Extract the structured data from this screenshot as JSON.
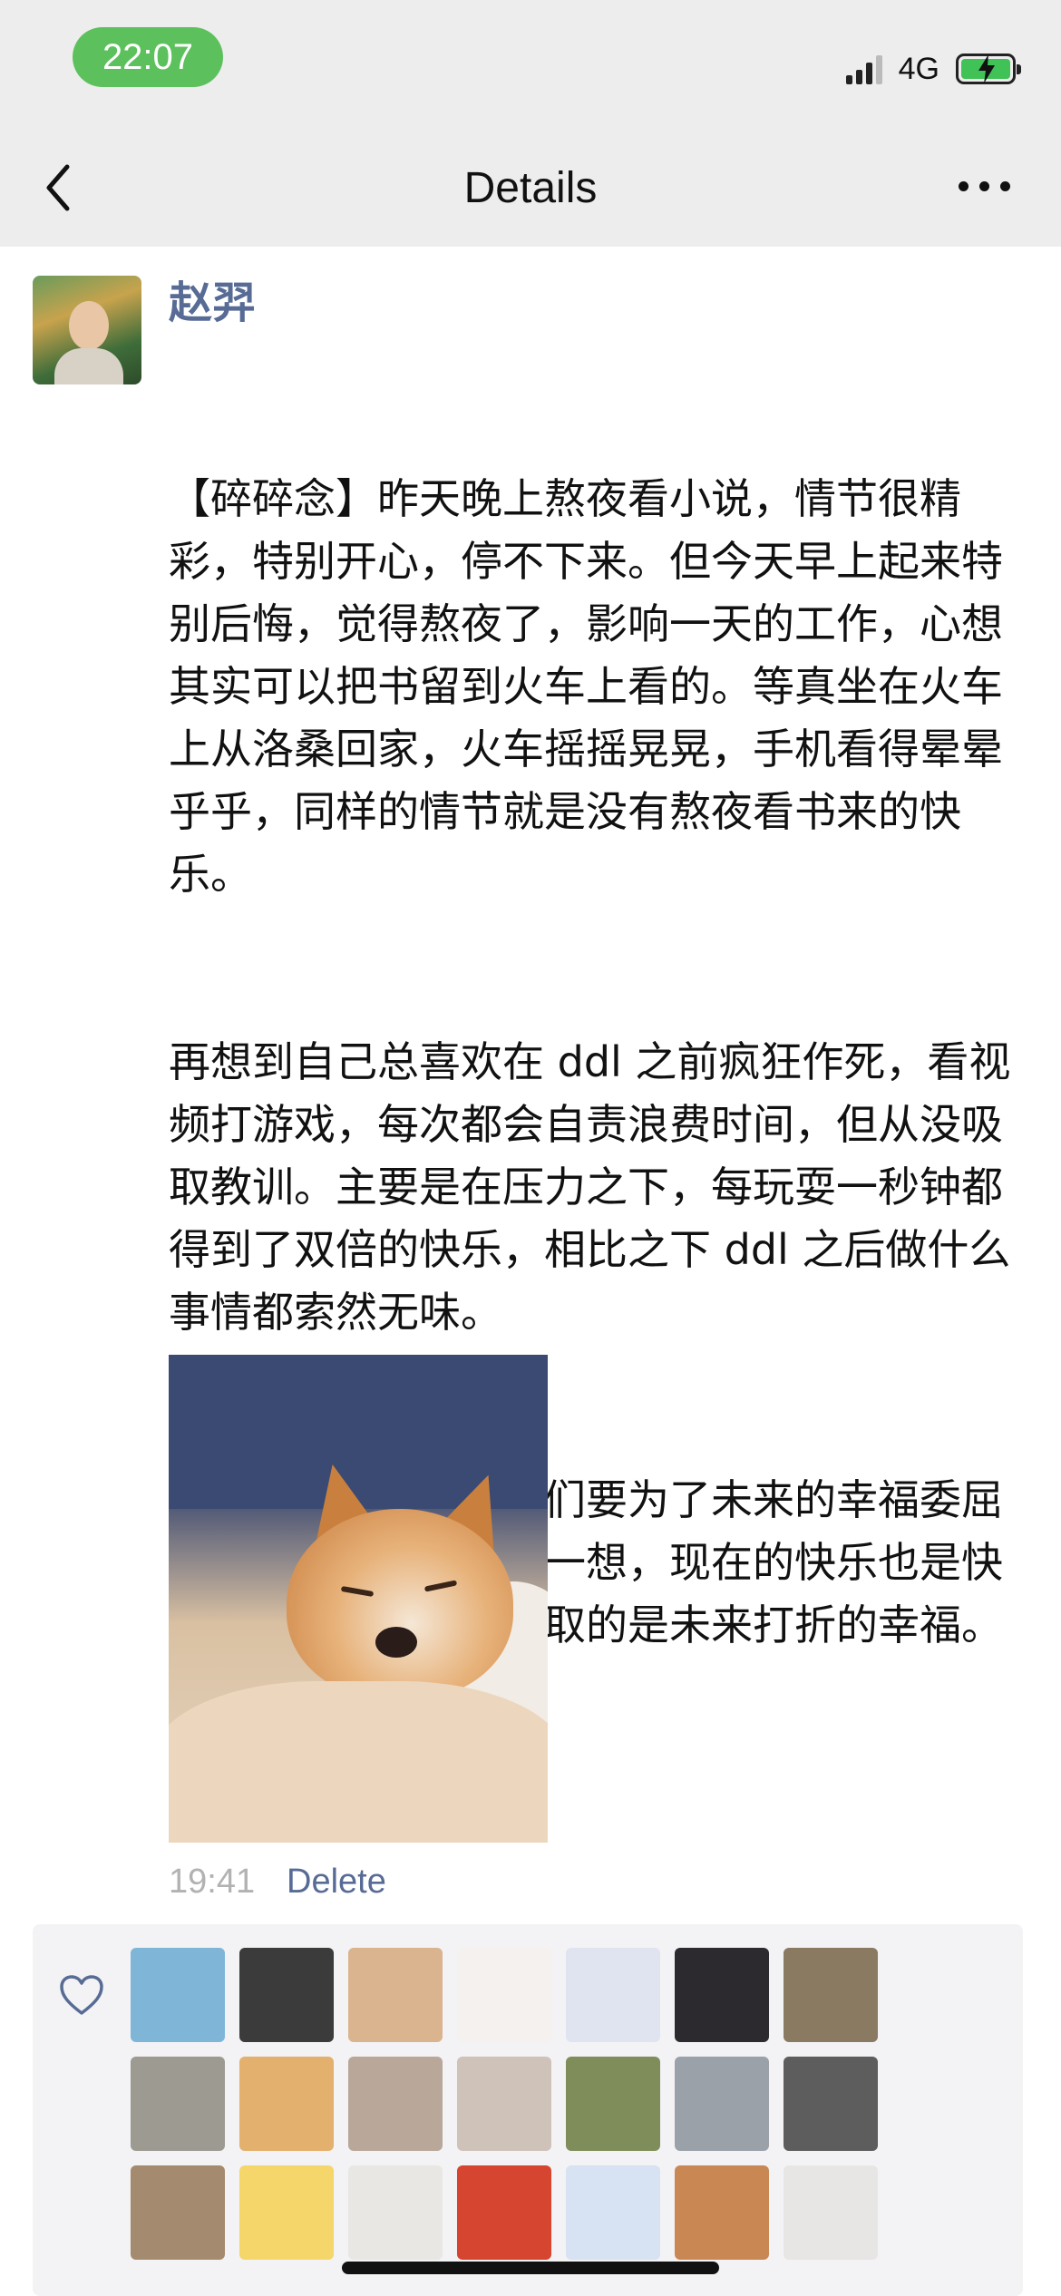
{
  "status_bar": {
    "time": "22:07",
    "network": "4G",
    "battery_state": "charging",
    "icons": [
      "signal-icon",
      "battery-charging-icon"
    ]
  },
  "nav": {
    "title": "Details",
    "back_icon": "chevron-left-icon",
    "more_icon": "more-dots-icon"
  },
  "post": {
    "author": "赵羿",
    "paragraphs": [
      "【碎碎念】昨天晚上熬夜看小说，情节很精彩，特别开心，停不下来。但今天早上起来特别后悔，觉得熬夜了，影响一天的工作，心想其实可以把书留到火车上看的。等真坐在火车上从洛桑回家，火车摇摇晃晃，手机看得晕晕乎乎，同样的情节就是没有熬夜看书来的快乐。",
      "再想到自己总喜欢在 ddl 之前疯狂作死，看视频打游戏，每次都会自责浪费时间，但从没吸取教训。主要是在压力之下，每玩耍一秒钟都得到了双倍的快乐，相比之下 ddl 之后做什么事情都索然无味。",
      "总是被灌鸡汤，说我们要为了未来的幸福委屈当下的自己。但仔细一想，现在的快乐也是快乐，牺牲当下可能换取的是未来打折的幸福。"
    ],
    "time": "19:41",
    "delete_label": "Delete"
  },
  "likes": {
    "icon": "heart-outline-icon",
    "avatars": [
      {
        "color": "#7fb6d8"
      },
      {
        "color": "#3b3b3b"
      },
      {
        "color": "#d9b48f"
      },
      {
        "color": "#f4f1ee"
      },
      {
        "color": "#dfe4f0"
      },
      {
        "color": "#2c2a2e"
      },
      {
        "color": "#8a7a62"
      },
      {
        "color": "#9d9a92"
      },
      {
        "color": "#e3b06d"
      },
      {
        "color": "#b9a79a"
      },
      {
        "color": "#cfc2b8"
      },
      {
        "color": "#7f8d5a"
      },
      {
        "color": "#9aa1a8"
      },
      {
        "color": "#5d5d5d"
      },
      {
        "color": "#a48a6e"
      },
      {
        "color": "#f5d66a"
      },
      {
        "color": "#e9e7e4"
      },
      {
        "color": "#d6452f"
      },
      {
        "color": "#d7e2f2"
      },
      {
        "color": "#c98754"
      },
      {
        "color": "#e8e6e4"
      }
    ]
  }
}
